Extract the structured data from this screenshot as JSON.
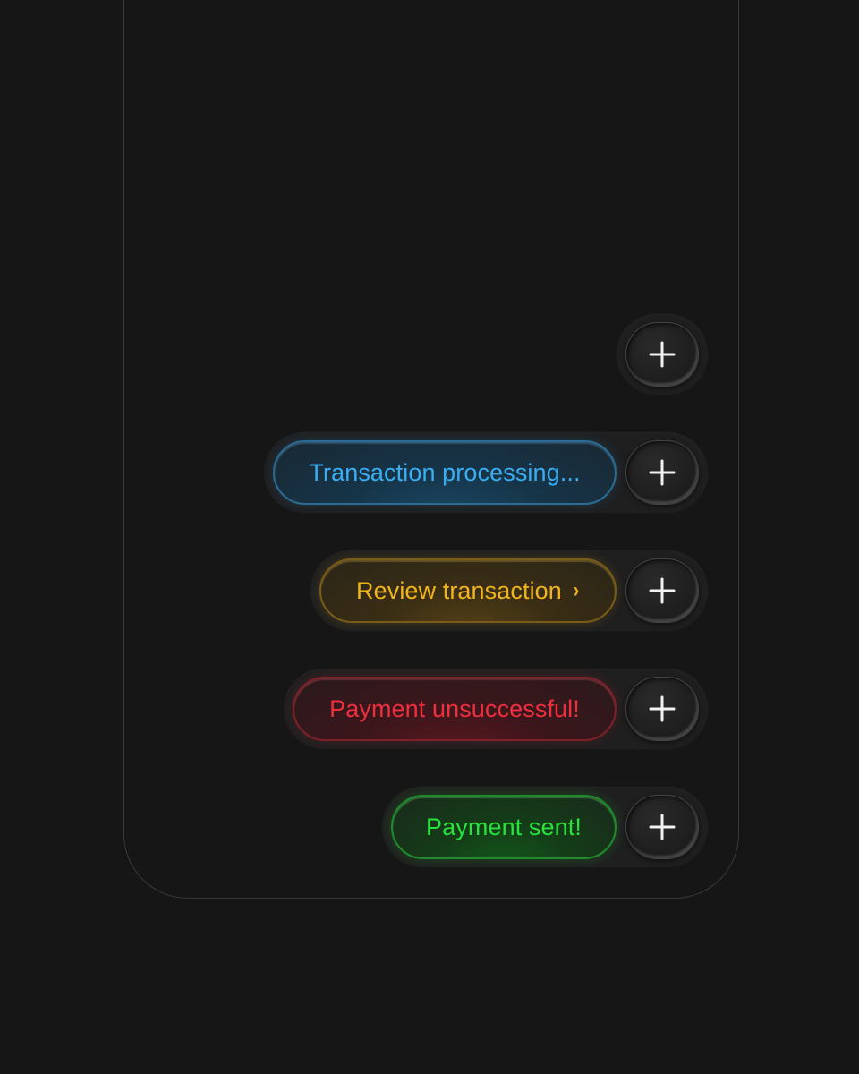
{
  "colors": {
    "background": "#161616",
    "processing": "#3aaef2",
    "review": "#f0b41d",
    "error": "#ef2f3d",
    "success": "#27e33b"
  },
  "add_button": {
    "icon": "plus-icon"
  },
  "states": [
    {
      "id": "idle"
    },
    {
      "id": "processing",
      "label": "Transaction processing..."
    },
    {
      "id": "review",
      "label": "Review transaction",
      "trailing_icon": "chevron-right-icon"
    },
    {
      "id": "error",
      "label": "Payment unsuccessful!"
    },
    {
      "id": "success",
      "label": "Payment sent!"
    }
  ]
}
